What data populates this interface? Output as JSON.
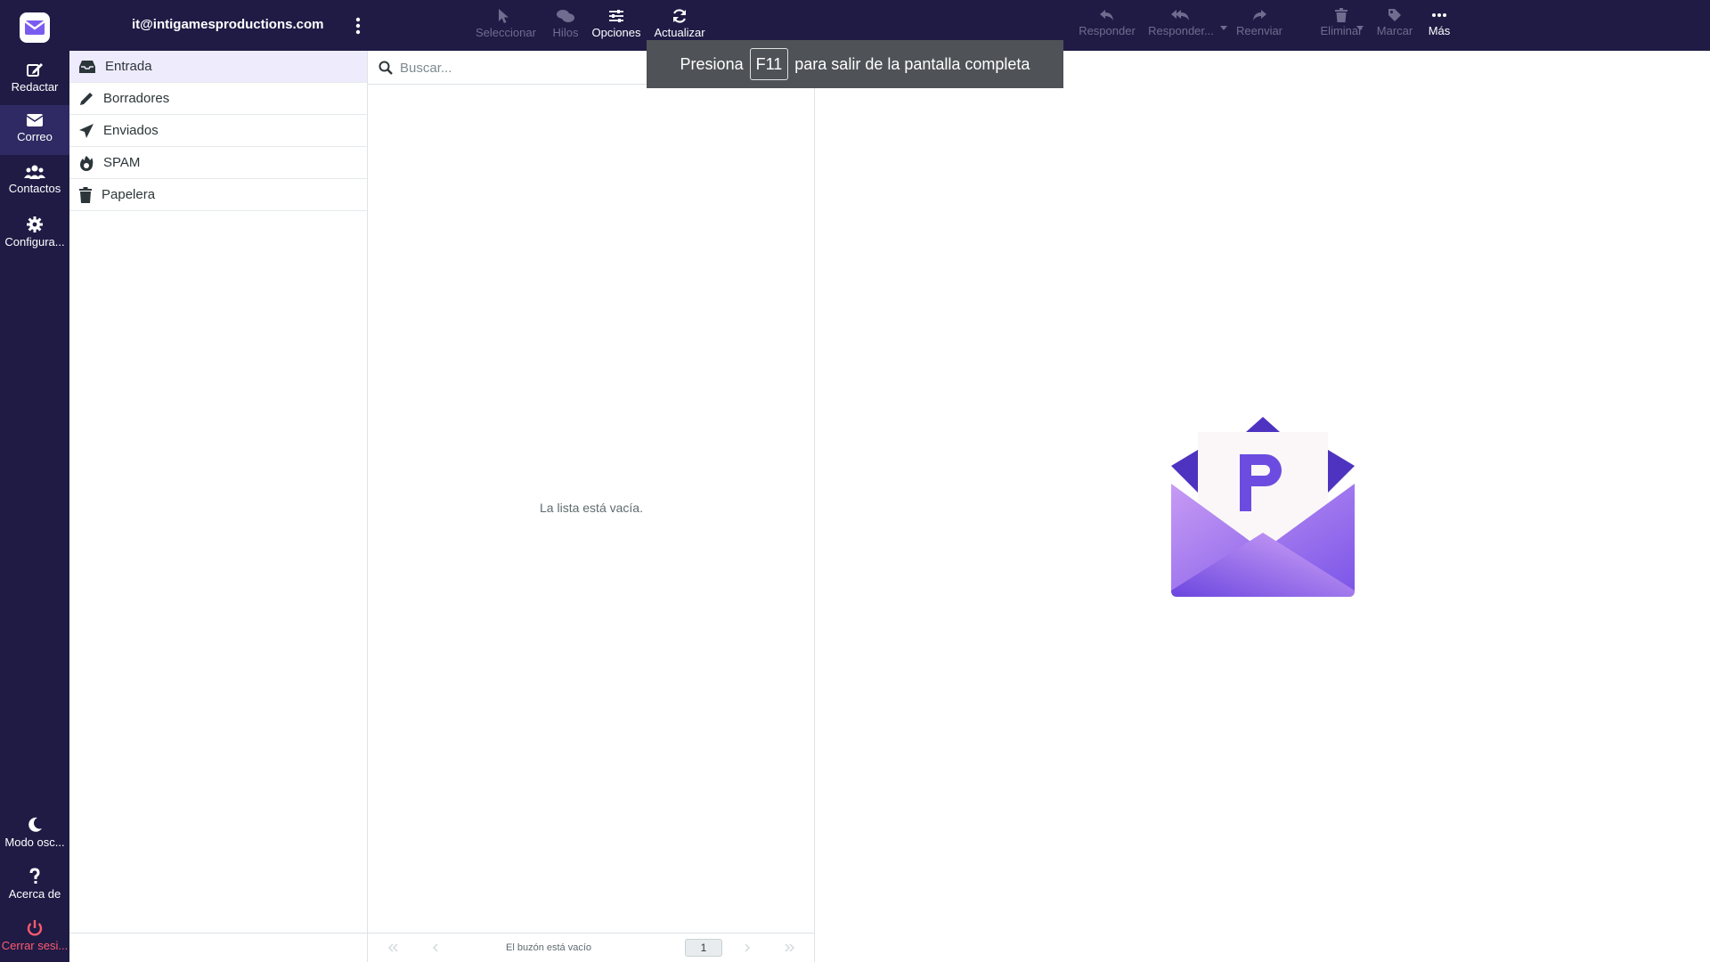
{
  "account": {
    "email": "it@intigamesproductions.com"
  },
  "nav": {
    "items": [
      {
        "label": "Redactar",
        "icon": "compose-icon"
      },
      {
        "label": "Correo",
        "icon": "envelope-icon"
      },
      {
        "label": "Contactos",
        "icon": "users-icon"
      },
      {
        "label": "Configura...",
        "icon": "gear-icon"
      }
    ],
    "bottom": [
      {
        "label": "Modo osc...",
        "icon": "moon-icon"
      },
      {
        "label": "Acerca de",
        "icon": "question-icon"
      },
      {
        "label": "Cerrar sesi...",
        "icon": "power-icon"
      }
    ]
  },
  "toolbar": {
    "list": [
      {
        "label": "Seleccionar",
        "icon": "pointer-icon",
        "enabled": false
      },
      {
        "label": "Hilos",
        "icon": "threads-icon",
        "enabled": false
      },
      {
        "label": "Opciones",
        "icon": "sliders-icon",
        "enabled": true
      },
      {
        "label": "Actualizar",
        "icon": "refresh-icon",
        "enabled": true
      }
    ],
    "message": [
      {
        "label": "Responder",
        "icon": "reply-icon",
        "enabled": false
      },
      {
        "label": "Responder...",
        "icon": "reply-all-icon",
        "enabled": false
      },
      {
        "label": "Reenviar",
        "icon": "forward-icon",
        "enabled": false
      },
      {
        "label": "Eliminar",
        "icon": "trash-icon",
        "enabled": false
      },
      {
        "label": "Marcar",
        "icon": "tag-icon",
        "enabled": false
      },
      {
        "label": "Más",
        "icon": "more-icon",
        "enabled": true
      }
    ]
  },
  "folders": [
    {
      "label": "Entrada",
      "icon": "inbox-icon",
      "active": true
    },
    {
      "label": "Borradores",
      "icon": "pencil-icon",
      "active": false
    },
    {
      "label": "Enviados",
      "icon": "paper-plane-icon",
      "active": false
    },
    {
      "label": "SPAM",
      "icon": "fire-icon",
      "active": false
    },
    {
      "label": "Papelera",
      "icon": "trash-icon",
      "active": false
    }
  ],
  "search": {
    "placeholder": "Buscar..."
  },
  "list": {
    "empty_message": "La lista está vacía."
  },
  "pager": {
    "count_text": "El buzón está vacío",
    "page": "1"
  },
  "fullscreen_toast": {
    "before": "Presiona",
    "key": "F11",
    "after": "para salir de la pantalla completa"
  },
  "colors": {
    "nav_bg": "#1f1b45",
    "accent": "#6c4ce0",
    "active_folder_bg": "#eeebfc",
    "logout": "#ff5b6e"
  }
}
